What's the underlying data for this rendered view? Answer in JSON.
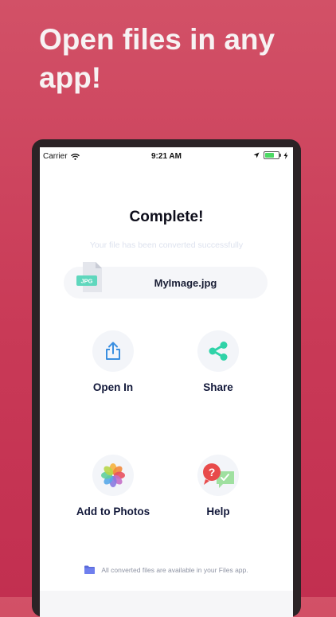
{
  "headline": "Open files in any app!",
  "status_bar": {
    "carrier": "Carrier",
    "time": "9:21 AM"
  },
  "result": {
    "title": "Complete!",
    "subtitle": "Your file has been converted successfully"
  },
  "file": {
    "type_badge": "JPG",
    "name": "MyImage.jpg"
  },
  "actions": {
    "open_in": "Open In",
    "share": "Share",
    "add_to_photos": "Add to Photos",
    "help": "Help"
  },
  "footer": {
    "note": "All converted files are available in your Files app."
  },
  "colors": {
    "accent_green": "#2fd3a8",
    "accent_blue": "#3b8fe0",
    "badge_teal": "#5fd7bd"
  }
}
